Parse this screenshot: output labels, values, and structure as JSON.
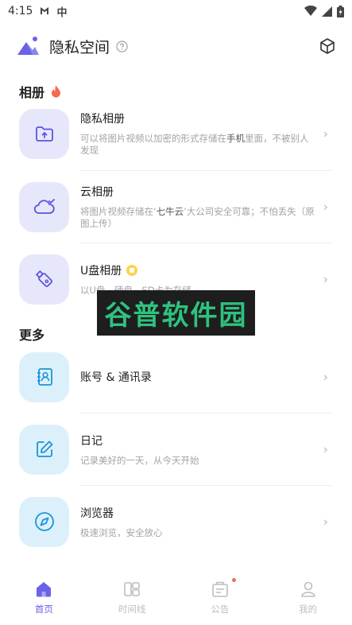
{
  "status_bar": {
    "time": "4:15",
    "glyph_a": "Ɣ",
    "glyph_b": "中"
  },
  "header": {
    "title": "隐私空间"
  },
  "sections": {
    "albums": {
      "title": "相册"
    },
    "more": {
      "title": "更多"
    }
  },
  "items": [
    {
      "title": "隐私相册",
      "desc_a": "可以将图片视频以加密的形式存储在",
      "desc_b": "手机",
      "desc_c": "里面，不被别人发现",
      "icon": "folder-upload-icon"
    },
    {
      "title": "云相册",
      "desc_a": "将图片视频存储在‘",
      "desc_b": "七牛云",
      "desc_c": "’大公司安全可靠；不怕丢失（原图上传）",
      "icon": "cloud-check-icon"
    },
    {
      "title": "U盘相册",
      "desc": "以U盘、硬盘、SD卡为存储",
      "icon": "usb-drive-icon",
      "badge": "vip-badge"
    },
    {
      "title": "账号 & 通讯录",
      "icon": "contact-book-icon"
    },
    {
      "title": "日记",
      "desc": "记录美好的一天，从今天开始",
      "icon": "edit-note-icon"
    },
    {
      "title": "浏览器",
      "desc": "极速浏览，安全放心",
      "icon": "compass-icon"
    }
  ],
  "watermark": {
    "text": "谷普软件园"
  },
  "nav": [
    {
      "label": "首页",
      "icon": "home-icon",
      "active": true
    },
    {
      "label": "时间线",
      "icon": "timeline-icon"
    },
    {
      "label": "公告",
      "icon": "announcement-icon",
      "dot": true
    },
    {
      "label": "我的",
      "icon": "profile-icon"
    }
  ],
  "colors": {
    "accent": "#6a63e8",
    "tile_purple": "#e7e7fb",
    "tile_blue": "#dcf0fb",
    "flame": "#f26a50",
    "watermark_green": "#2ec27e"
  }
}
